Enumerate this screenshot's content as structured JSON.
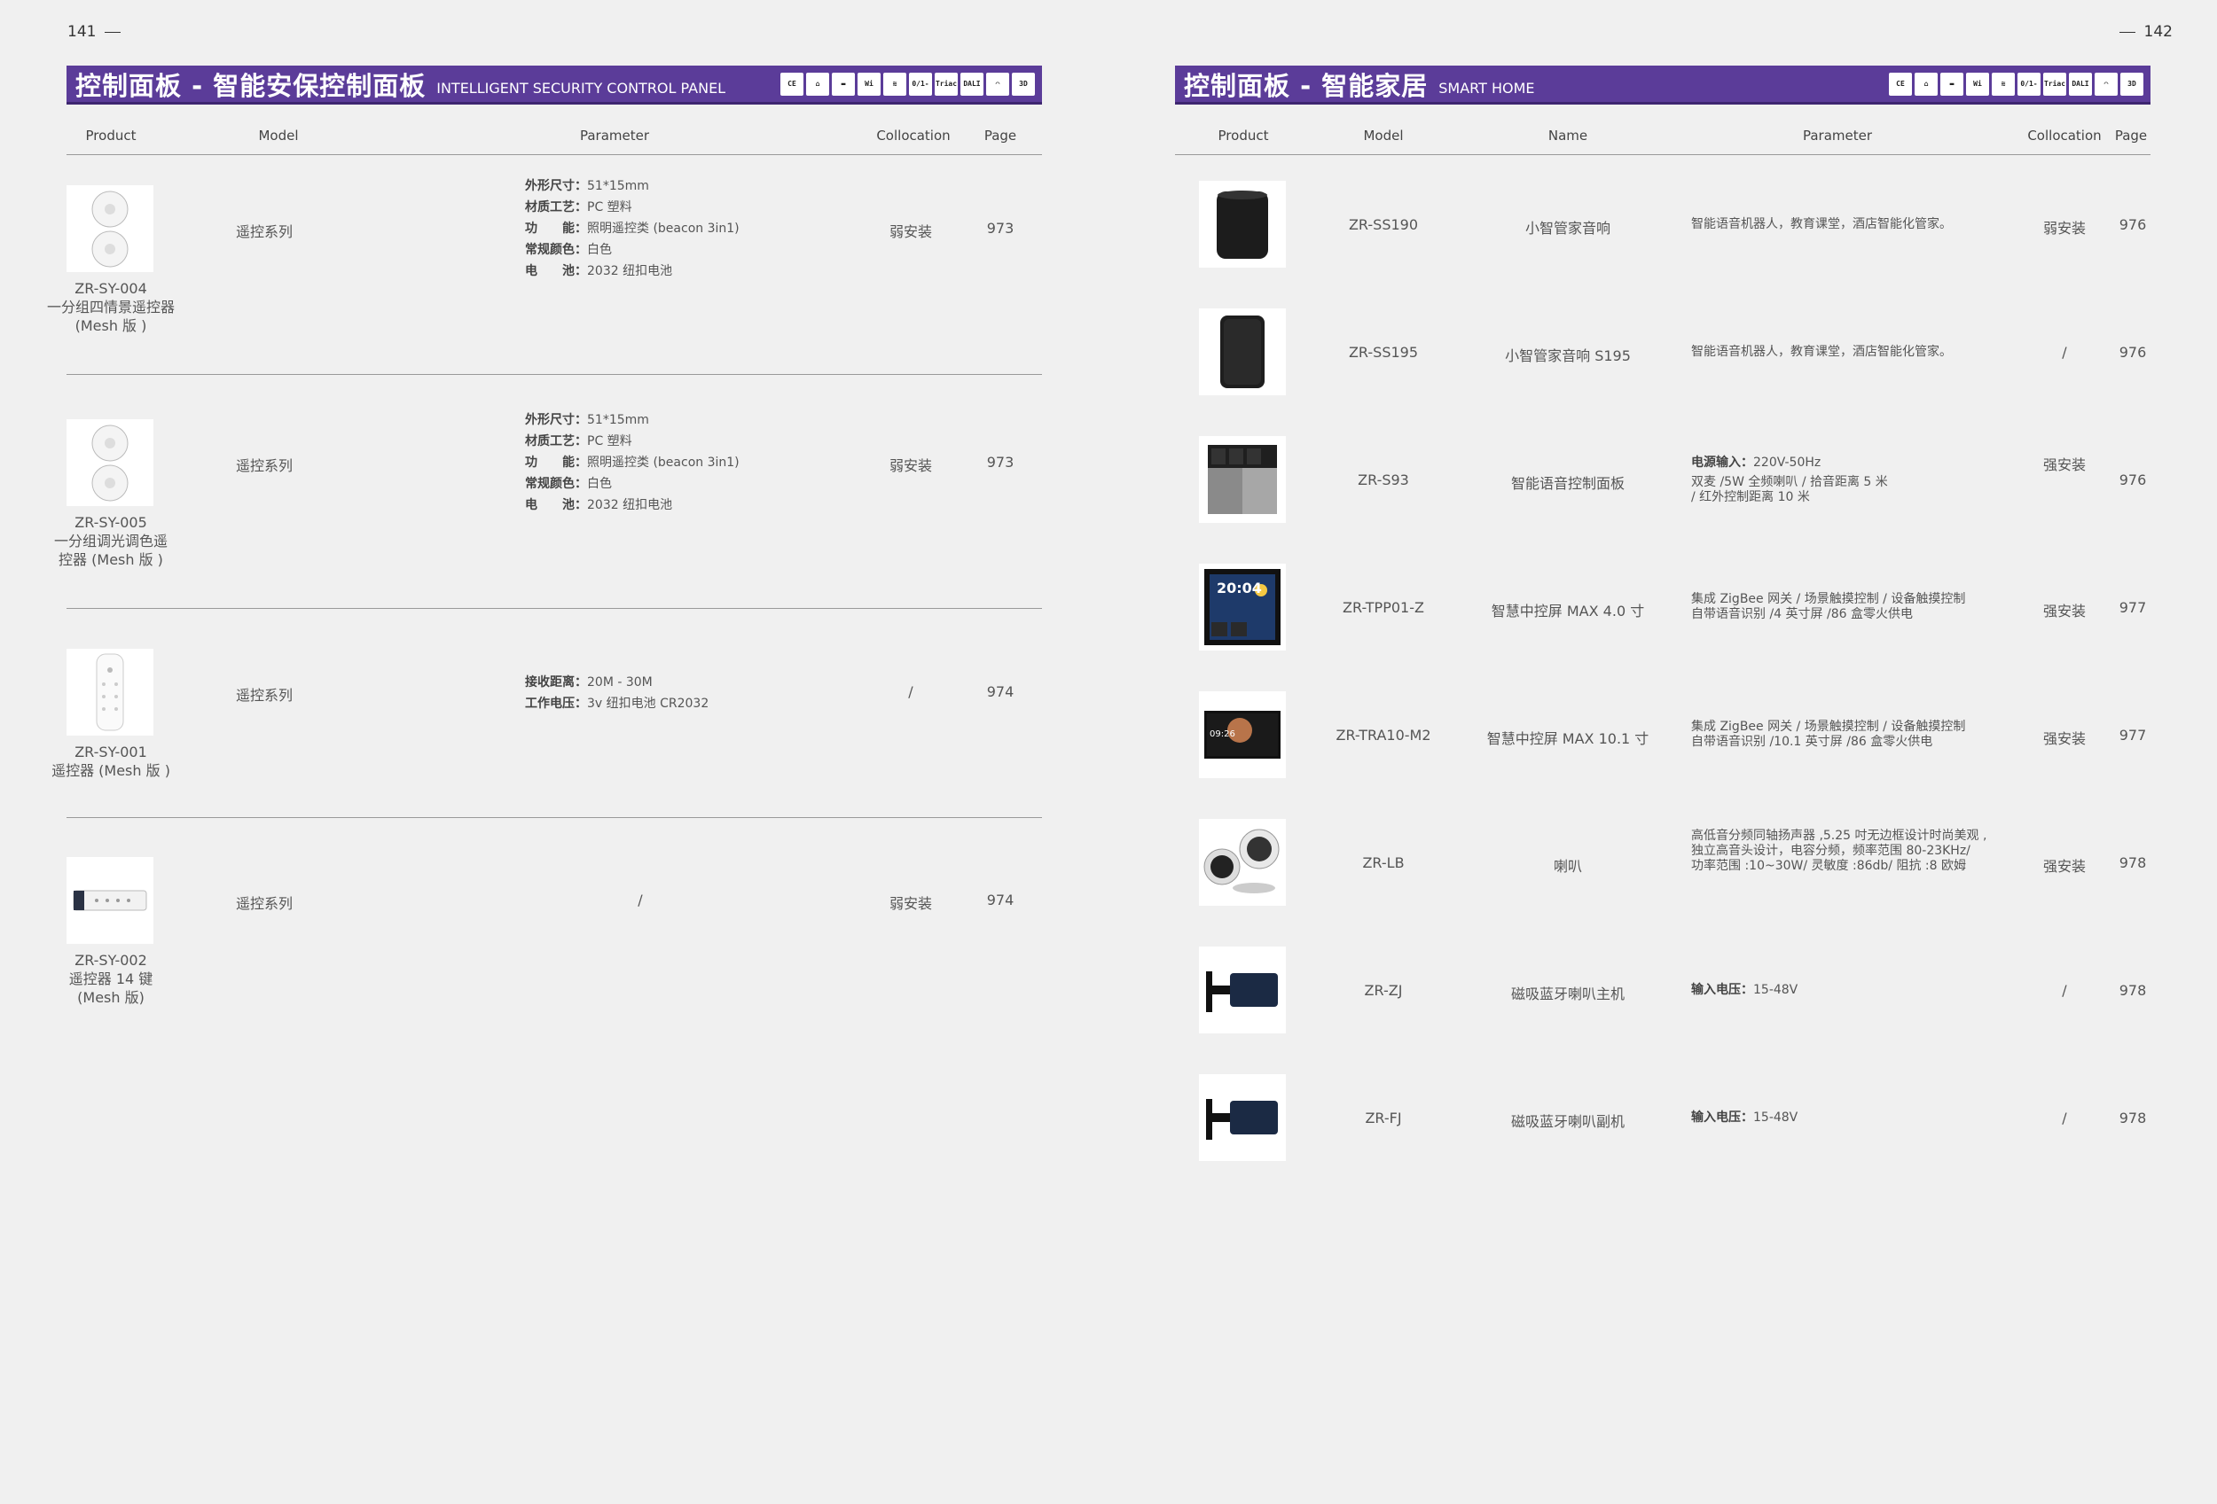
{
  "left_page": {
    "page_number": "141",
    "banner": {
      "title_cn": "控制面板 - 智能安保控制面板",
      "title_en": "INTELLIGENT SECURITY CONTROL PANEL"
    },
    "icons": [
      "CE",
      "⌂",
      "▬",
      "Wi",
      "≋",
      "0/1-10V",
      "Triac DIM",
      "DALI DIM",
      "◠",
      "3D"
    ],
    "headers": {
      "product": "Product",
      "model": "Model",
      "parameter": "Parameter",
      "collocation": "Collocation",
      "page": "Page"
    },
    "rows": [
      {
        "code": "ZR-SY-004",
        "name_lines": [
          "一分组四情景遥控器",
          "(Mesh 版 )"
        ],
        "model": "遥控系列",
        "params": [
          {
            "k": "外形尺寸：",
            "v": "51*15mm"
          },
          {
            "k": "材质工艺：",
            "v": "PC 塑料"
          },
          {
            "k": "功　　能：",
            "v": "照明遥控类 (beacon 3in1)"
          },
          {
            "k": "常规颜色：",
            "v": "白色"
          },
          {
            "k": "电　　池：",
            "v": "2032 纽扣电池"
          }
        ],
        "collocation": "弱安装",
        "page": "973"
      },
      {
        "code": "ZR-SY-005",
        "name_lines": [
          "一分组调光调色遥",
          "控器 (Mesh 版 )"
        ],
        "model": "遥控系列",
        "params": [
          {
            "k": "外形尺寸：",
            "v": "51*15mm"
          },
          {
            "k": "材质工艺：",
            "v": "PC 塑料"
          },
          {
            "k": "功　　能：",
            "v": "照明遥控类 (beacon 3in1)"
          },
          {
            "k": "常规颜色：",
            "v": "白色"
          },
          {
            "k": "电　　池：",
            "v": "2032 纽扣电池"
          }
        ],
        "collocation": "弱安装",
        "page": "973"
      },
      {
        "code": "ZR-SY-001",
        "name_lines": [
          "遥控器 (Mesh 版 )"
        ],
        "model": "遥控系列",
        "params": [
          {
            "k": "接收距离：",
            "v": "20M - 30M"
          },
          {
            "k": "工作电压：",
            "v": "3v 纽扣电池 CR2032"
          }
        ],
        "collocation": "/",
        "page": "974"
      },
      {
        "code": "ZR-SY-002",
        "name_lines": [
          "遥控器 14 键",
          "(Mesh 版)"
        ],
        "model": "遥控系列",
        "params_text": "/",
        "collocation": "弱安装",
        "page": "974"
      }
    ]
  },
  "right_page": {
    "page_number": "142",
    "banner": {
      "title_cn": "控制面板 - 智能家居",
      "title_en": "SMART HOME"
    },
    "icons": [
      "CE",
      "⌂",
      "▬",
      "Wi",
      "≋",
      "0/1-10V",
      "Triac DIM",
      "DALI DIM",
      "◠",
      "3D"
    ],
    "headers": {
      "product": "Product",
      "model": "Model",
      "name": "Name",
      "parameter": "Parameter",
      "collocation": "Collocation",
      "page": "Page"
    },
    "rows": [
      {
        "model": "ZR-SS190",
        "name": "小智管家音响",
        "param_lines": [
          "智能语音机器人，教育课堂，酒店智能化管家。"
        ],
        "collocation": "弱安装",
        "page": "976"
      },
      {
        "model": "ZR-SS195",
        "name": "小智管家音响 S195",
        "param_lines": [
          "智能语音机器人，教育课堂，酒店智能化管家。"
        ],
        "collocation": "/",
        "page": "976"
      },
      {
        "model": "ZR-S93",
        "name": "智能语音控制面板",
        "param_key": "电源输入：",
        "param_key_val": "220V-50Hz",
        "param_lines": [
          "双麦 /5W 全频喇叭 / 拾音距离 5 米",
          "/ 红外控制距离 10 米"
        ],
        "collocation": "强安装",
        "page": "976"
      },
      {
        "model": "ZR-TPP01-Z",
        "name": "智慧中控屏 MAX  4.0 寸",
        "param_lines": [
          "集成 ZigBee 网关 / 场景触摸控制 / 设备触摸控制",
          "自带语音识别 /4 英寸屏 /86 盒零火供电"
        ],
        "collocation": "强安装",
        "page": "977",
        "screen_time": "20:04"
      },
      {
        "model": "ZR-TRA10-M2",
        "name": "智慧中控屏 MAX  10.1 寸",
        "param_lines": [
          "集成 ZigBee 网关 / 场景触摸控制 / 设备触摸控制",
          "自带语音识别 /10.1 英寸屏 /86 盒零火供电"
        ],
        "collocation": "强安装",
        "page": "977",
        "screen_time": "09:26"
      },
      {
        "model": "ZR-LB",
        "name": "喇叭",
        "param_lines": [
          "高低音分频同轴扬声器 ,5.25 吋无边框设计时尚美观 ,",
          "独立高音头设计，电容分频，频率范围 80-23KHz/",
          "功率范围 :10~30W/ 灵敏度 :86db/ 阻抗 :8 欧姆"
        ],
        "collocation": "强安装",
        "page": "978"
      },
      {
        "model": "ZR-ZJ",
        "name": "磁吸蓝牙喇叭主机",
        "param_key": "输入电压：",
        "param_key_val": "15-48V",
        "param_lines": [],
        "collocation": "/",
        "page": "978"
      },
      {
        "model": "ZR-FJ",
        "name": "磁吸蓝牙喇叭副机",
        "param_key": "输入电压：",
        "param_key_val": "15-48V",
        "param_lines": [],
        "collocation": "/",
        "page": "978"
      }
    ]
  }
}
